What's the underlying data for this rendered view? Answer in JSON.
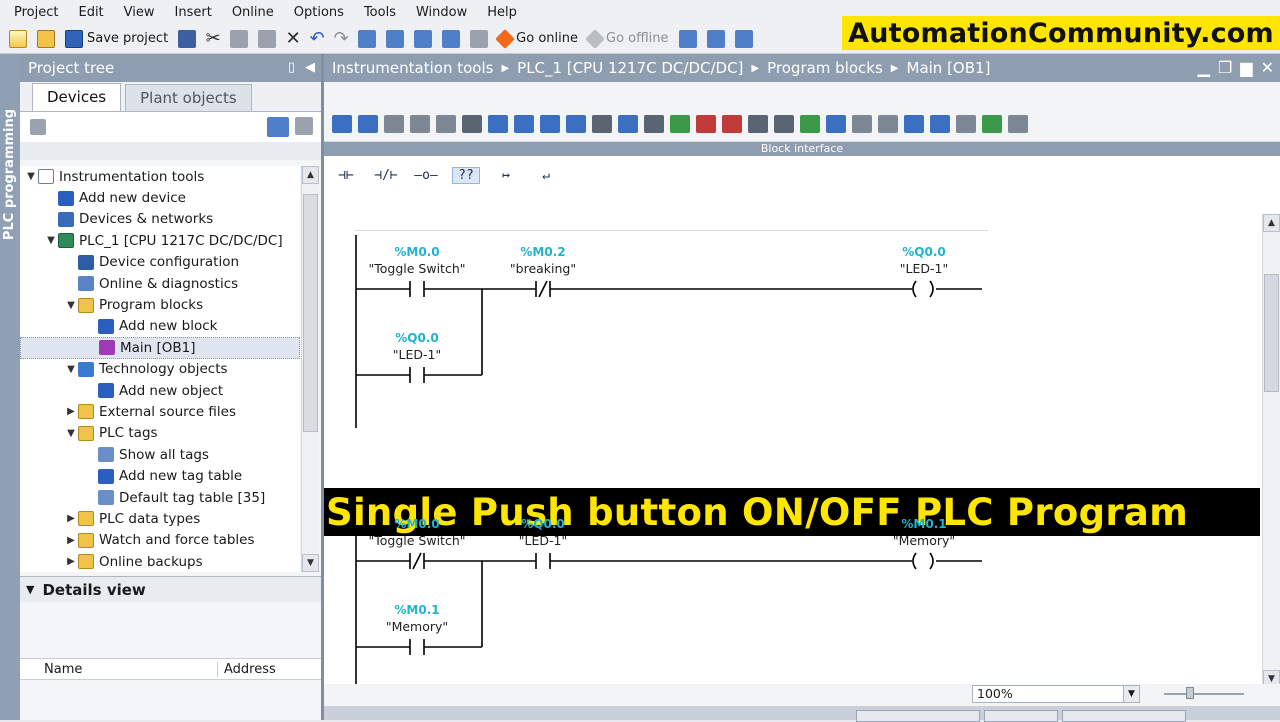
{
  "menu": [
    "Project",
    "Edit",
    "View",
    "Insert",
    "Online",
    "Options",
    "Tools",
    "Window",
    "Help"
  ],
  "toolbar": {
    "save_label": "Save project",
    "go_online_label": "Go online",
    "go_offline_label": "Go offline"
  },
  "watermark": "AutomationCommunity.com",
  "vertical_tab": "PLC programming",
  "project_tree": {
    "title": "Project tree",
    "tabs": [
      "Devices",
      "Plant objects"
    ],
    "items": [
      {
        "label": "Instrumentation tools",
        "icon": "project-icon",
        "arrow": "▼"
      },
      {
        "label": "Add new device",
        "icon": "add-device-icon",
        "arrow": ""
      },
      {
        "label": "Devices & networks",
        "icon": "network-icon",
        "arrow": ""
      },
      {
        "label": "PLC_1 [CPU 1217C DC/DC/DC]",
        "icon": "plc-icon",
        "arrow": "▼"
      },
      {
        "label": "Device configuration",
        "icon": "device-config-icon",
        "arrow": ""
      },
      {
        "label": "Online & diagnostics",
        "icon": "diagnostics-icon",
        "arrow": ""
      },
      {
        "label": "Program blocks",
        "icon": "folder-icon",
        "arrow": "▼"
      },
      {
        "label": "Add new block",
        "icon": "add-block-icon",
        "arrow": ""
      },
      {
        "label": "Main [OB1]",
        "icon": "main-block-icon",
        "arrow": ""
      },
      {
        "label": "Technology objects",
        "icon": "technology-icon",
        "arrow": "▼"
      },
      {
        "label": "Add new object",
        "icon": "add-object-icon",
        "arrow": ""
      },
      {
        "label": "External source files",
        "icon": "folder-icon",
        "arrow": "▶"
      },
      {
        "label": "PLC tags",
        "icon": "folder-icon",
        "arrow": "▼"
      },
      {
        "label": "Show all tags",
        "icon": "tags-icon",
        "arrow": ""
      },
      {
        "label": "Add new tag table",
        "icon": "add-tag-table-icon",
        "arrow": ""
      },
      {
        "label": "Default tag table [35]",
        "icon": "tag-table-icon",
        "arrow": ""
      },
      {
        "label": "PLC data types",
        "icon": "folder-icon",
        "arrow": "▶"
      },
      {
        "label": "Watch and force tables",
        "icon": "folder-icon",
        "arrow": "▶"
      },
      {
        "label": "Online backups",
        "icon": "folder-icon",
        "arrow": "▶"
      }
    ]
  },
  "details_view": {
    "title": "Details view",
    "columns": [
      "Name",
      "Address"
    ]
  },
  "editor": {
    "breadcrumb": [
      "Instrumentation tools",
      "PLC_1 [CPU 1217C DC/DC/DC]",
      "Program blocks",
      "Main [OB1]"
    ],
    "block_interface_label": "Block interface",
    "zoom": "100%"
  },
  "ladder_tools": [
    "⊣⊢",
    "⊣/⊢",
    "–o–",
    "??",
    "↦",
    "↵"
  ],
  "networks": [
    {
      "main_contact": {
        "address": "%M0.0",
        "tag": "\"Toggle Switch\"",
        "type": "NO"
      },
      "series_contact": {
        "address": "%M0.2",
        "tag": "\"breaking\"",
        "type": "NC"
      },
      "coil": {
        "address": "%Q0.0",
        "tag": "\"LED-1\""
      },
      "branch_contact": {
        "address": "%Q0.0",
        "tag": "\"LED-1\"",
        "type": "NO"
      }
    },
    {
      "main_contact": {
        "address": "%M0.0",
        "tag": "\"Toggle Switch\"",
        "type": "NC"
      },
      "series_contact": {
        "address": "%Q0.0",
        "tag": "\"LED-1\"",
        "type": "NO"
      },
      "coil": {
        "address": "%M0.1",
        "tag": "\"Memory\""
      },
      "branch_contact": {
        "address": "%M0.1",
        "tag": "\"Memory\"",
        "type": "NO"
      }
    }
  ],
  "banner": "Single Push button ON/OFF PLC Program"
}
